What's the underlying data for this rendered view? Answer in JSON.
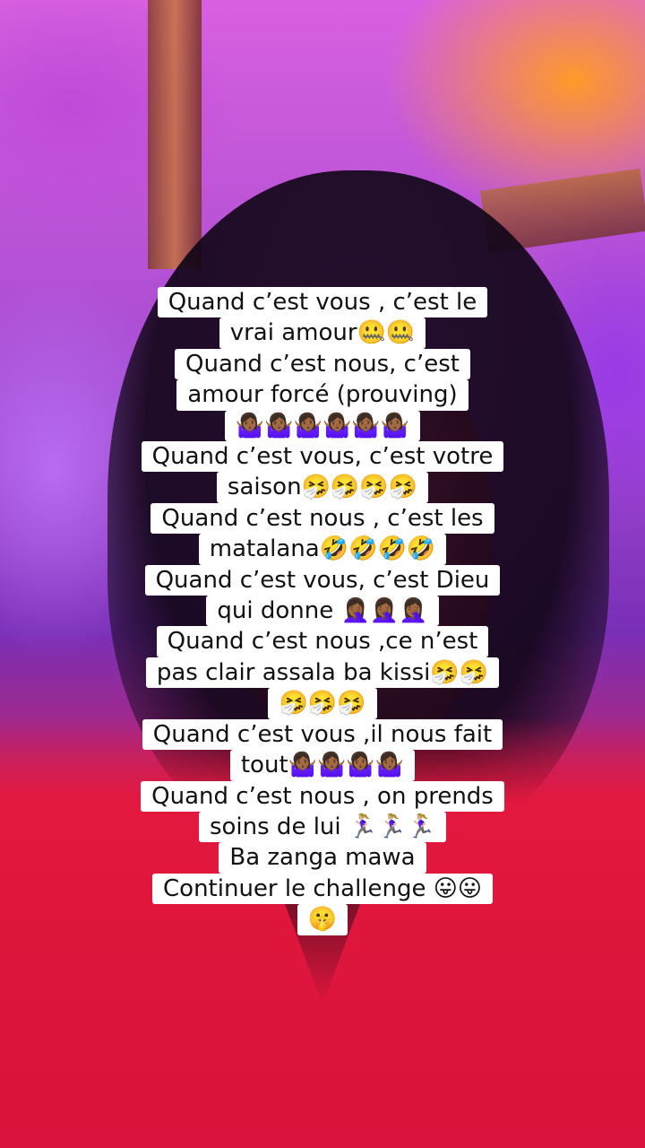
{
  "caption": {
    "lines": [
      "Quand c’est vous , c’est le",
      "vrai amour🤐🤐",
      "Quand c’est nous, c’est",
      "amour forcé (prouving)",
      "🤷🏾‍♀️🤷🏾‍♀️🤷🏾‍♀️🤷🏾‍♀️🤷🏾‍♀️🤷🏾‍♀️",
      "Quand c’est vous, c’est votre",
      "saison🤧🤧🤧🤧",
      "Quand c’est nous , c’est les",
      "matalana🤣🤣🤣🤣",
      "Quand c’est vous, c’est Dieu",
      "qui donne 🤦🏾‍♀️🤦🏾‍♀️🤦🏾‍♀️",
      "Quand c’est nous ,ce n’est",
      "pas clair assala ba kissi🤧🤧",
      "🤧🤧🤧",
      "Quand c’est vous ,il nous fait",
      "tout🤷🏾‍♀️🤷🏾‍♀️🤷🏾‍♀️🤷🏾‍♀️",
      "Quand c’est nous , on prends",
      "soins de lui 🏃🏼‍♀️🏃🏼‍♀️🏃🏼‍♀️",
      "Ba zanga mawa",
      "Continuer le challenge 😛😛",
      "🤫"
    ]
  }
}
